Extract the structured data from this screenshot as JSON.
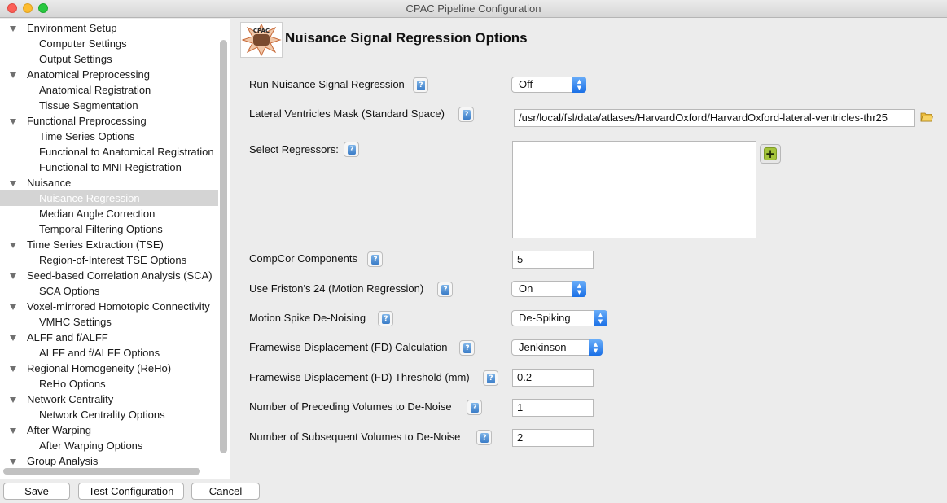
{
  "window": {
    "title": "CPAC Pipeline Configuration"
  },
  "tree": {
    "items": [
      {
        "label": "Environment Setup",
        "level": 0,
        "expanded": true
      },
      {
        "label": "Computer Settings",
        "level": 1
      },
      {
        "label": "Output Settings",
        "level": 1
      },
      {
        "label": "Anatomical Preprocessing",
        "level": 0,
        "expanded": true
      },
      {
        "label": "Anatomical Registration",
        "level": 1
      },
      {
        "label": "Tissue Segmentation",
        "level": 1
      },
      {
        "label": "Functional Preprocessing",
        "level": 0,
        "expanded": true
      },
      {
        "label": "Time Series Options",
        "level": 1
      },
      {
        "label": "Functional to Anatomical Registration",
        "level": 1
      },
      {
        "label": "Functional to MNI Registration",
        "level": 1
      },
      {
        "label": "Nuisance",
        "level": 0,
        "expanded": true
      },
      {
        "label": "Nuisance Regression",
        "level": 1,
        "selected": true
      },
      {
        "label": "Median Angle Correction",
        "level": 1
      },
      {
        "label": "Temporal Filtering Options",
        "level": 1
      },
      {
        "label": "Time Series Extraction (TSE)",
        "level": 0,
        "expanded": true
      },
      {
        "label": "Region-of-Interest TSE Options",
        "level": 1
      },
      {
        "label": "Seed-based Correlation Analysis (SCA)",
        "level": 0,
        "expanded": true
      },
      {
        "label": "SCA Options",
        "level": 1
      },
      {
        "label": "Voxel-mirrored Homotopic Connectivity",
        "level": 0,
        "expanded": true
      },
      {
        "label": "VMHC Settings",
        "level": 1
      },
      {
        "label": "ALFF and f/ALFF",
        "level": 0,
        "expanded": true
      },
      {
        "label": "ALFF and f/ALFF Options",
        "level": 1
      },
      {
        "label": "Regional Homogeneity (ReHo)",
        "level": 0,
        "expanded": true
      },
      {
        "label": "ReHo Options",
        "level": 1
      },
      {
        "label": "Network Centrality",
        "level": 0,
        "expanded": true
      },
      {
        "label": "Network Centrality Options",
        "level": 1
      },
      {
        "label": "After Warping",
        "level": 0,
        "expanded": true
      },
      {
        "label": "After Warping Options",
        "level": 1
      },
      {
        "label": "Group Analysis",
        "level": 0,
        "expanded": true
      }
    ]
  },
  "buttons": {
    "save": "Save",
    "test": "Test Configuration",
    "cancel": "Cancel"
  },
  "page": {
    "logo_text": "CPAC",
    "title": "Nuisance Signal Regression Options"
  },
  "fields": {
    "run_nuisance": {
      "label": "Run Nuisance Signal Regression",
      "value": "Off"
    },
    "lateral_ventricles": {
      "label": "Lateral Ventricles Mask (Standard Space)",
      "value": "/usr/local/fsl/data/atlases/HarvardOxford/HarvardOxford-lateral-ventricles-thr25"
    },
    "select_regressors": {
      "label": "Select Regressors:"
    },
    "compcor": {
      "label": "CompCor Components",
      "value": "5"
    },
    "friston": {
      "label": "Use Friston's 24 (Motion Regression)",
      "value": "On"
    },
    "motion_spike": {
      "label": "Motion Spike De-Noising",
      "value": "De-Spiking"
    },
    "fd_calc": {
      "label": "Framewise Displacement (FD) Calculation",
      "value": "Jenkinson"
    },
    "fd_threshold": {
      "label": "Framewise Displacement (FD) Threshold (mm)",
      "value": "0.2"
    },
    "preceding": {
      "label": "Number of Preceding Volumes to De-Noise",
      "value": "1"
    },
    "subsequent": {
      "label": "Number of Subsequent Volumes to De-Noise",
      "value": "2"
    }
  },
  "icons": {
    "help": "help-icon",
    "add": "add-icon",
    "folder": "folder-icon",
    "expand": "disclosure-triangle-icon"
  },
  "colors": {
    "stepper_blue": "#1a6fe6",
    "selection_gray": "#d4d4d4",
    "add_green": "#a4c43a"
  }
}
